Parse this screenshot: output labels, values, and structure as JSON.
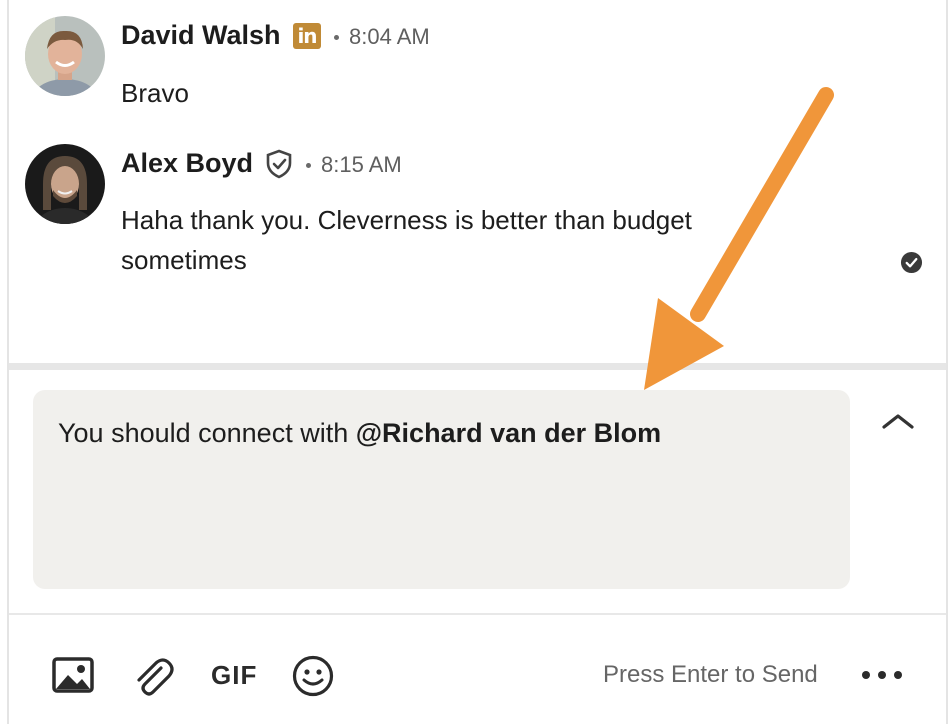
{
  "messages": [
    {
      "sender": "David Walsh",
      "badge": "in",
      "time": "8:04 AM",
      "text": "Bravo"
    },
    {
      "sender": "Alex Boyd",
      "badge": "verified-shield",
      "time": "8:15 AM",
      "text_line1": "Haha thank you. Cleverness is better than budget",
      "text_line2": "sometimes",
      "status": "read"
    }
  ],
  "composer": {
    "text_prefix": "You should connect with ",
    "mention": "@Richard van der Blom"
  },
  "toolbar": {
    "image_icon": "image-icon",
    "attach_icon": "paperclip-icon",
    "gif_label": "GIF",
    "emoji_icon": "emoji-icon",
    "send_hint": "Press Enter to Send",
    "more_icon": "more-options-icon"
  },
  "colors": {
    "linkedin_badge": "#c08a36",
    "compose_bg": "#f1f0ed",
    "annotation_arrow": "#f0963a"
  }
}
